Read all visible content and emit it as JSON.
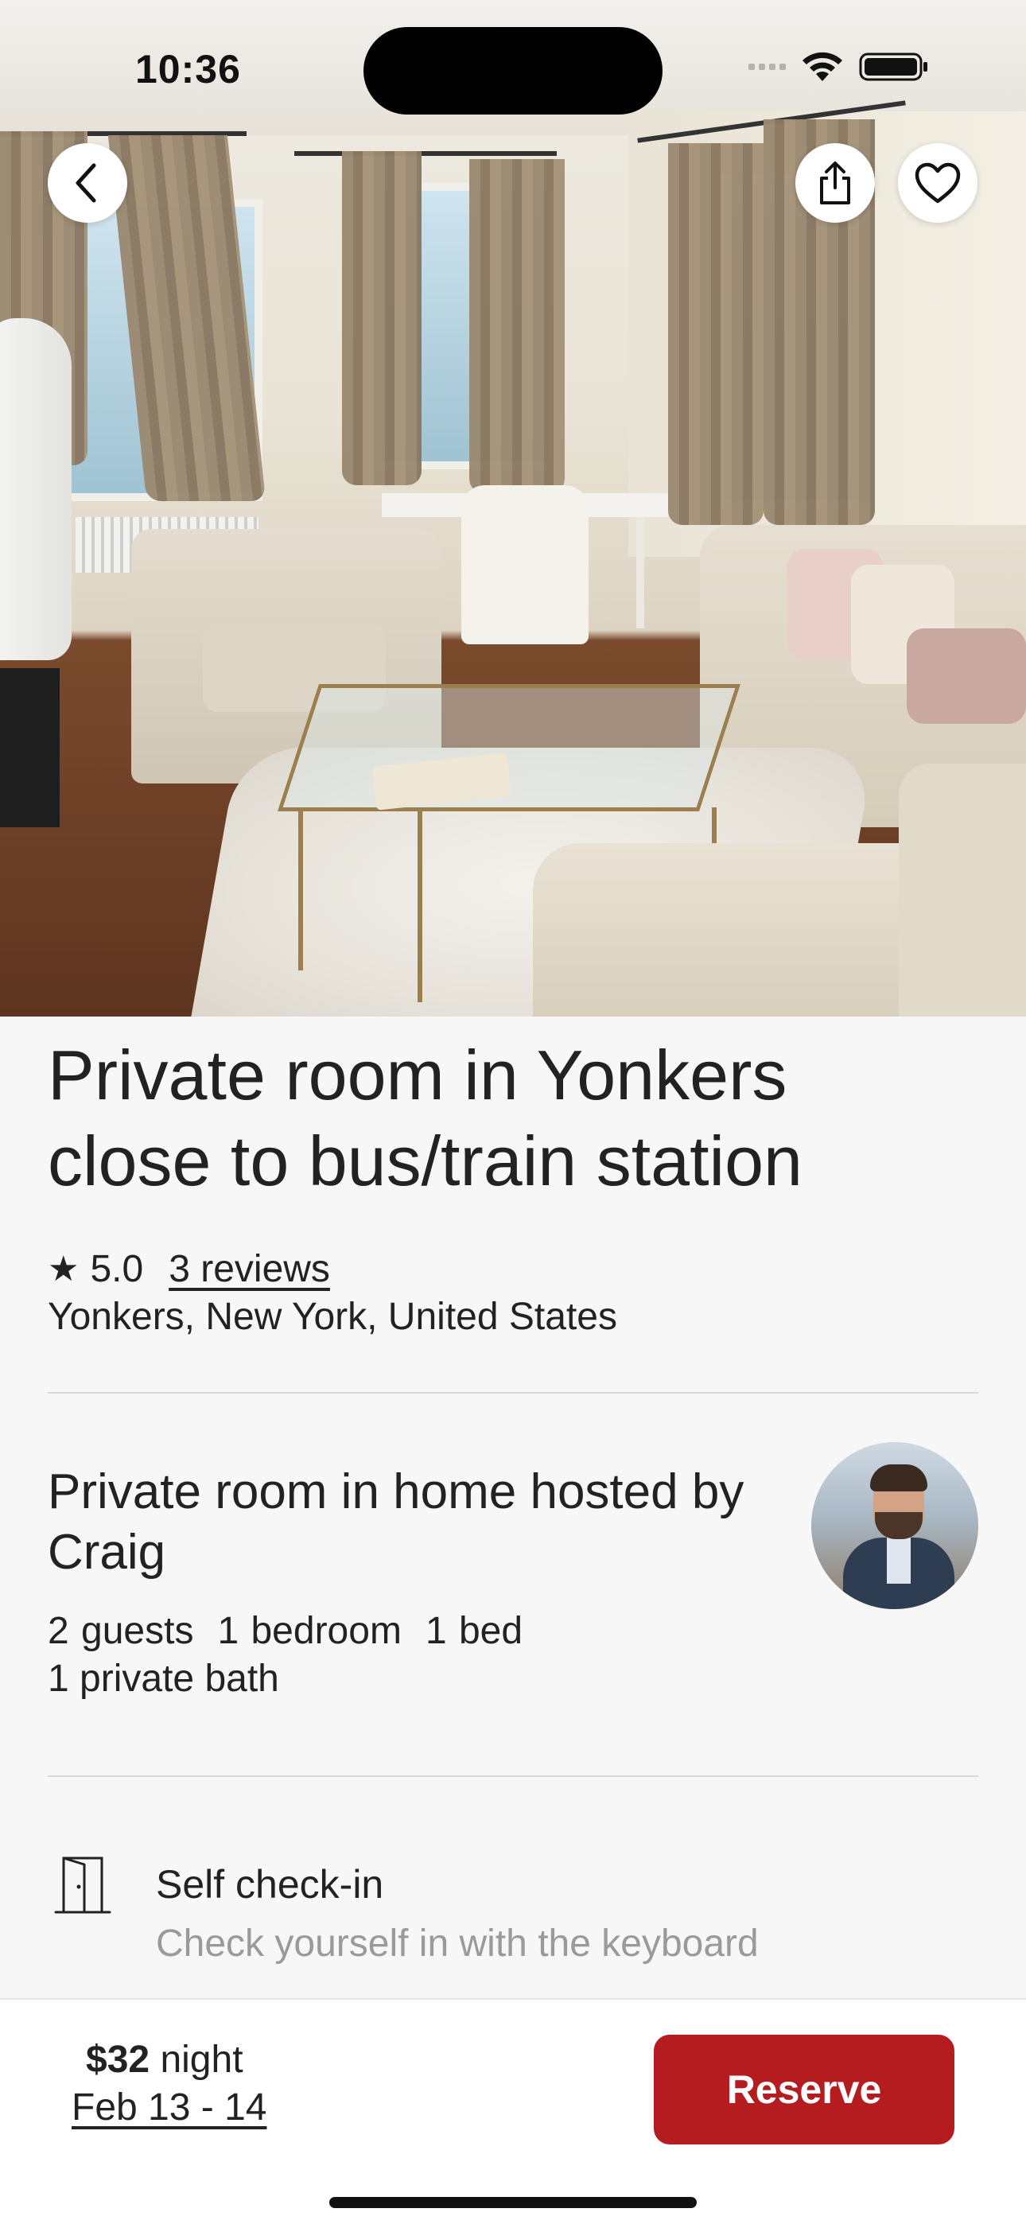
{
  "status_bar": {
    "time": "10:36"
  },
  "header": {
    "back_icon": "chevron-left-icon",
    "share_icon": "share-icon",
    "favorite_icon": "heart-outline-icon"
  },
  "listing": {
    "title": "Private room in Yonkers close to bus/train station",
    "rating_icon": "star-icon",
    "rating": "5.0",
    "reviews_label": "3 reviews",
    "location": "Yonkers, New York, United States"
  },
  "host": {
    "summary": "Private room in home hosted by Craig",
    "specs": [
      "2 guests",
      "1 bedroom",
      "1 bed"
    ],
    "bath": "1 private bath"
  },
  "features": [
    {
      "icon": "door-icon",
      "title": "Self check-in",
      "description": "Check yourself in with the keyboard"
    }
  ],
  "footer": {
    "price": "$32",
    "price_unit": "night",
    "dates": "Feb 13 - 14",
    "reserve_label": "Reserve"
  },
  "colors": {
    "accent": "#b51c1f",
    "text": "#222222",
    "muted": "#9a9a9a"
  }
}
